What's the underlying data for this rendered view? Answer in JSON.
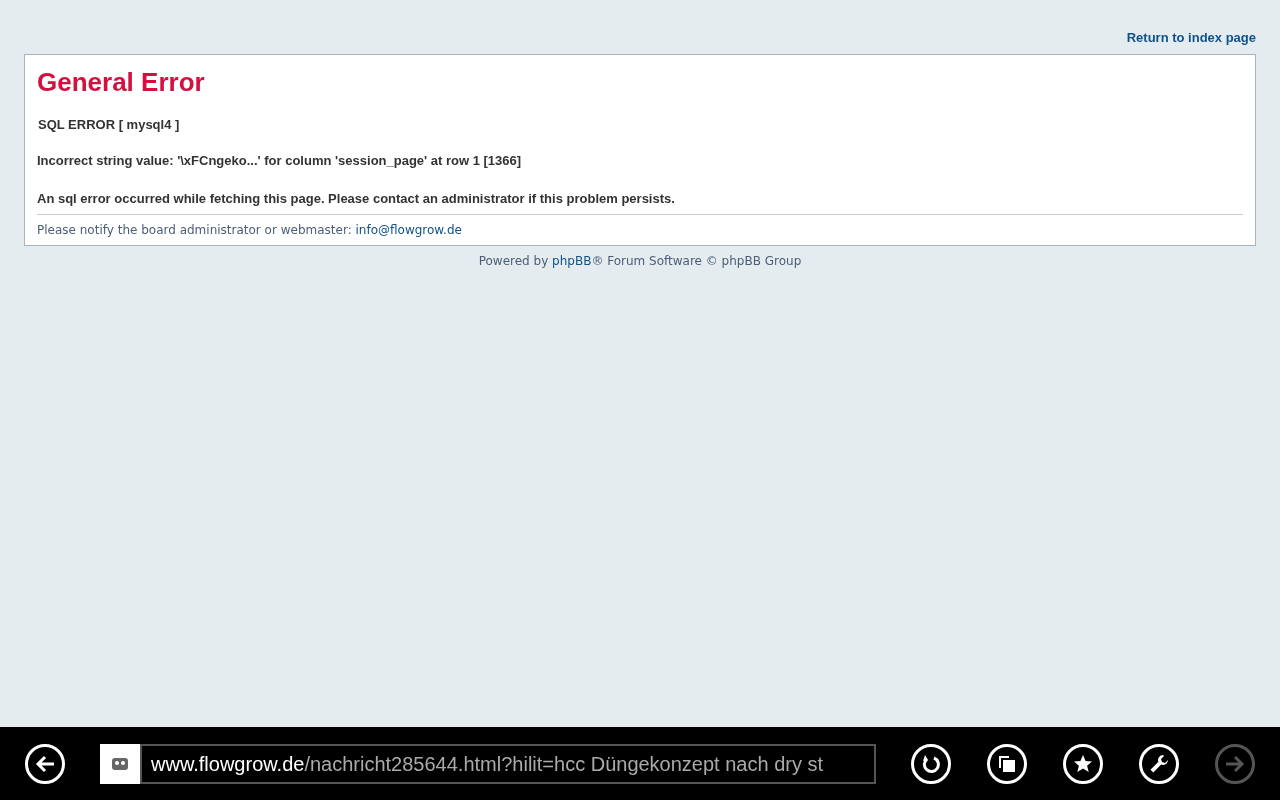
{
  "header": {
    "return_link": "Return to index page"
  },
  "error_panel": {
    "title": "General Error",
    "sql_error": "SQL ERROR [ mysql4 ]",
    "detail": "Incorrect string value: '\\xFCngeko...' for column 'session_page' at row 1 [1366]",
    "message": "An sql error occurred while fetching this page. Please contact an administrator if this problem persists.",
    "notify_text": "Please notify the board administrator or webmaster:",
    "notify_email": "info@flowgrow.de"
  },
  "footer": {
    "powered_by": "Powered by",
    "phpbb_link": "phpBB",
    "rest": "® Forum Software © phpBB Group"
  },
  "browser_bar": {
    "address": {
      "domain": "www.flowgrow.de",
      "path": "/nachricht285644.html?hilit=hcc Düngekonzept nach dry st"
    },
    "buttons": [
      {
        "kind": "refresh",
        "disabled": false
      },
      {
        "kind": "tabs",
        "disabled": false
      },
      {
        "kind": "favorites",
        "disabled": false
      },
      {
        "kind": "tools",
        "disabled": false
      },
      {
        "kind": "forward",
        "disabled": true
      }
    ]
  }
}
